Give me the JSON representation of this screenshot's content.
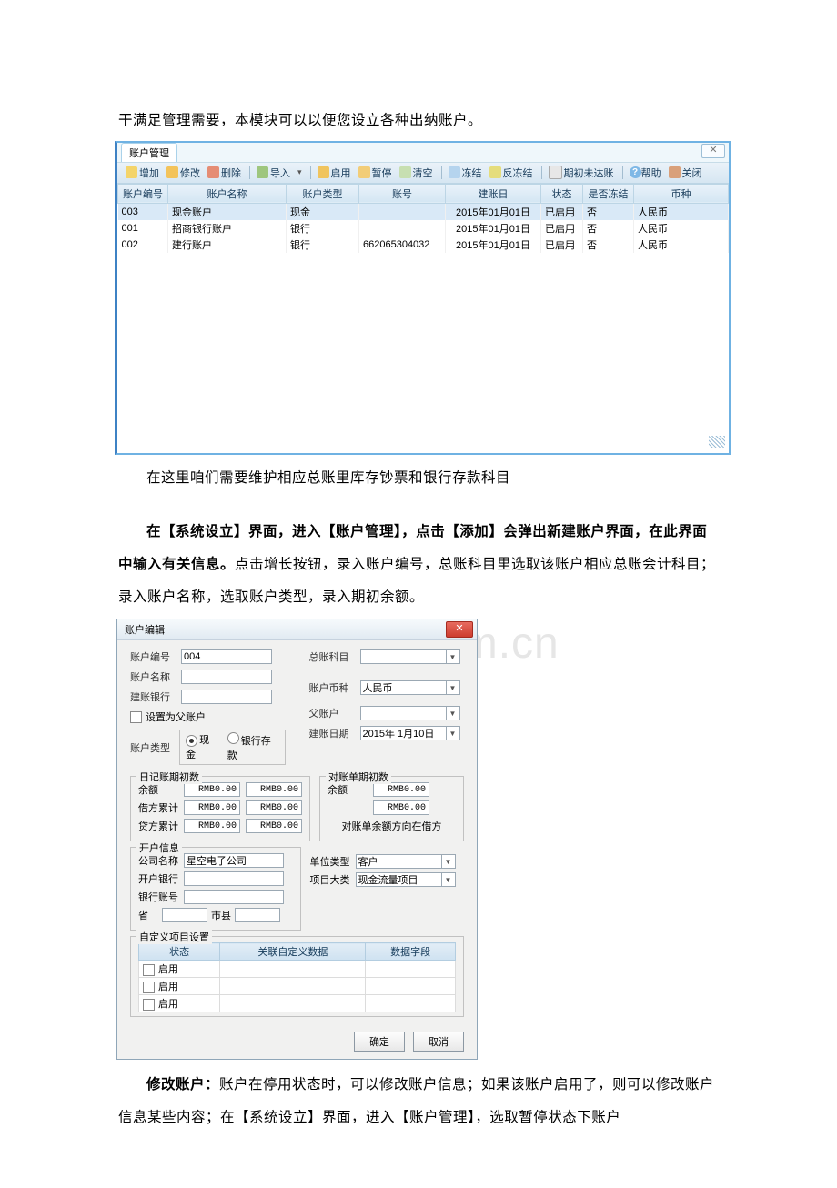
{
  "watermark": "www.zixin.com.cn",
  "text": {
    "intro": "干满足管理需要，本模块可以以便您设立各种出纳账户。",
    "after_table": "在这里咱们需要维护相应总账里库存钞票和银行存款科目",
    "para2_bold": "在【系统设立】界面，进入【账户管理】，点击【添加】会弹出新建账户界面，在此界面中输入有关信息。",
    "para2_rest": "点击增长按钮，录入账户编号，总账科目里选取该账户相应总账会计科目；录入账户名称，选取账户类型，录入期初余额。",
    "modify_bold": "修改账户：",
    "modify_rest": "账户在停用状态时，可以修改账户信息；如果该账户启用了，则可以修改账户信息某些内容；在【系统设立】界面，进入【账户管理】，选取暂停状态下账户"
  },
  "amgmt": {
    "tab": "账户管理",
    "close": "✕",
    "toolbar": {
      "add": "增加",
      "edit": "修改",
      "del": "删除",
      "import": "导入",
      "dropdown": "▾",
      "enable": "启用",
      "pause": "暂停",
      "clear": "清空",
      "freeze": "冻结",
      "unfreeze": "反冻结",
      "init": "期初未达账",
      "help": "帮助",
      "close": "关闭"
    },
    "cols": [
      "账户编号",
      "账户名称",
      "账户类型",
      "账号",
      "建账日",
      "状态",
      "是否冻结",
      "币种"
    ],
    "rows": [
      {
        "no": "003",
        "name": "现金账户",
        "type": "现金",
        "acct": "",
        "date": "2015年01月01日",
        "status": "已启用",
        "frozen": "否",
        "currency": "人民币",
        "sel": true
      },
      {
        "no": "001",
        "name": "招商银行账户",
        "type": "银行",
        "acct": "",
        "date": "2015年01月01日",
        "status": "已启用",
        "frozen": "否",
        "currency": "人民币"
      },
      {
        "no": "002",
        "name": "建行账户",
        "type": "银行",
        "acct": "662065304032",
        "date": "2015年01月01日",
        "status": "已启用",
        "frozen": "否",
        "currency": "人民币"
      }
    ]
  },
  "aedit": {
    "title": "账户编辑",
    "labels": {
      "code": "账户编号",
      "name": "账户名称",
      "bank": "建账银行",
      "gl": "总账科目",
      "curr": "账户币种",
      "parent": "父账户",
      "setparent": "设置为父账户",
      "type": "账户类型",
      "cash": "现金",
      "deposit": "银行存款",
      "date": "建账日期"
    },
    "values": {
      "code": "004",
      "curr": "人民币",
      "date": "2015年 1月10日"
    },
    "journal": {
      "legend": "日记账期初数",
      "balance": "余额",
      "debit": "借方累计",
      "credit": "贷方累计",
      "rmb": "RMB0.00"
    },
    "recon": {
      "legend": "对账单期初数",
      "balance": "余额",
      "rmb": "RMB0.00",
      "note": "对账单余额方向在借方"
    },
    "open": {
      "legend": "开户信息",
      "company": "公司名称",
      "company_val": "星空电子公司",
      "bank": "开户银行",
      "acct": "银行账号",
      "prov": "省",
      "city": "市县",
      "unit_type": "单位类型",
      "unit_type_val": "客户",
      "proj": "项目大类",
      "proj_val": "现金流量项目"
    },
    "custom": {
      "legend": "自定义项目设置",
      "cols": [
        "状态",
        "关联自定义数据",
        "数据字段"
      ],
      "status": "启用"
    },
    "buttons": {
      "ok": "确定",
      "cancel": "取消"
    }
  }
}
